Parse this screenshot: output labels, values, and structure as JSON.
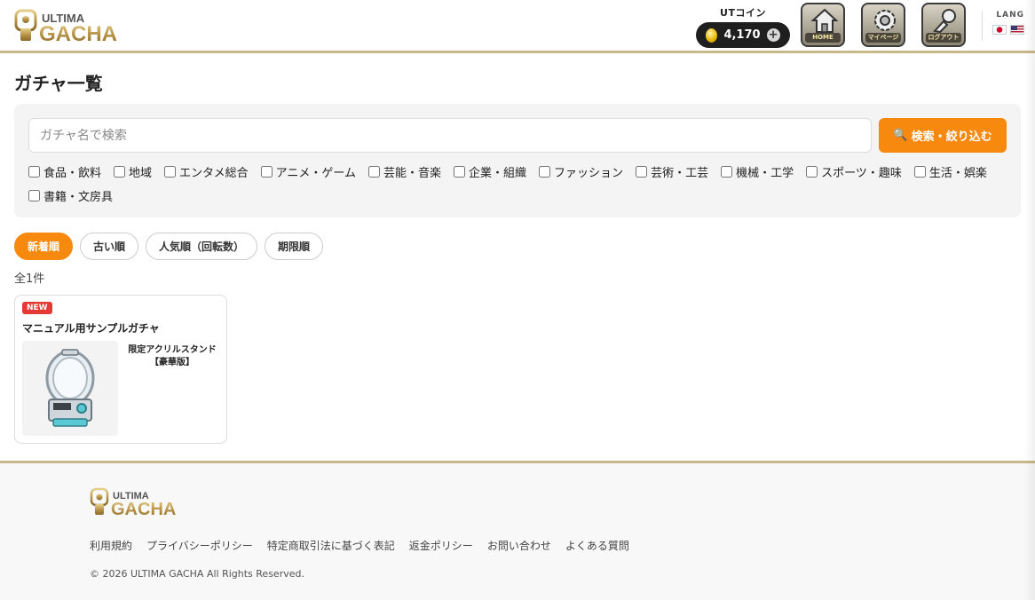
{
  "header": {
    "logo_top": "ULTIMA",
    "logo_bottom": "GACHA",
    "coin_label": "UTコイン",
    "coin_amount": "4,170",
    "coin_add": "+",
    "nav": [
      {
        "label": "HOME",
        "icon": "home-icon"
      },
      {
        "label": "マイページ",
        "icon": "gear-icon"
      },
      {
        "label": "ログアウト",
        "icon": "logout-icon"
      }
    ],
    "lang_label": "LANG"
  },
  "main": {
    "title": "ガチャ一覧",
    "search": {
      "placeholder": "ガチャ名で検索",
      "button_label": "検索・絞り込む"
    },
    "categories": [
      "食品・飲料",
      "地域",
      "エンタメ総合",
      "アニメ・ゲーム",
      "芸能・音楽",
      "企業・組織",
      "ファッション",
      "芸術・工芸",
      "機械・工学",
      "スポーツ・趣味",
      "生活・娯楽",
      "書籍・文房具"
    ],
    "sort": [
      {
        "label": "新着順",
        "active": true
      },
      {
        "label": "古い順",
        "active": false
      },
      {
        "label": "人気順（回転数）",
        "active": false
      },
      {
        "label": "期限順",
        "active": false
      }
    ],
    "count": "全1件",
    "items": [
      {
        "badge": "NEW",
        "title": "マニュアル用サンプルガチャ",
        "prize": "限定アクリルスタンド【豪華版】"
      }
    ]
  },
  "footer": {
    "logo_top": "ULTIMA",
    "logo_bottom": "GACHA",
    "links": [
      "利用規約",
      "プライバシーポリシー",
      "特定商取引法に基づく表記",
      "返金ポリシー",
      "お問い合わせ",
      "よくある質問"
    ],
    "copyright": "© 2026 ULTIMA GACHA All Rights Reserved."
  },
  "colors": {
    "accent": "#f7890f",
    "gold": "#b8954a",
    "badge_red": "#e53935"
  }
}
